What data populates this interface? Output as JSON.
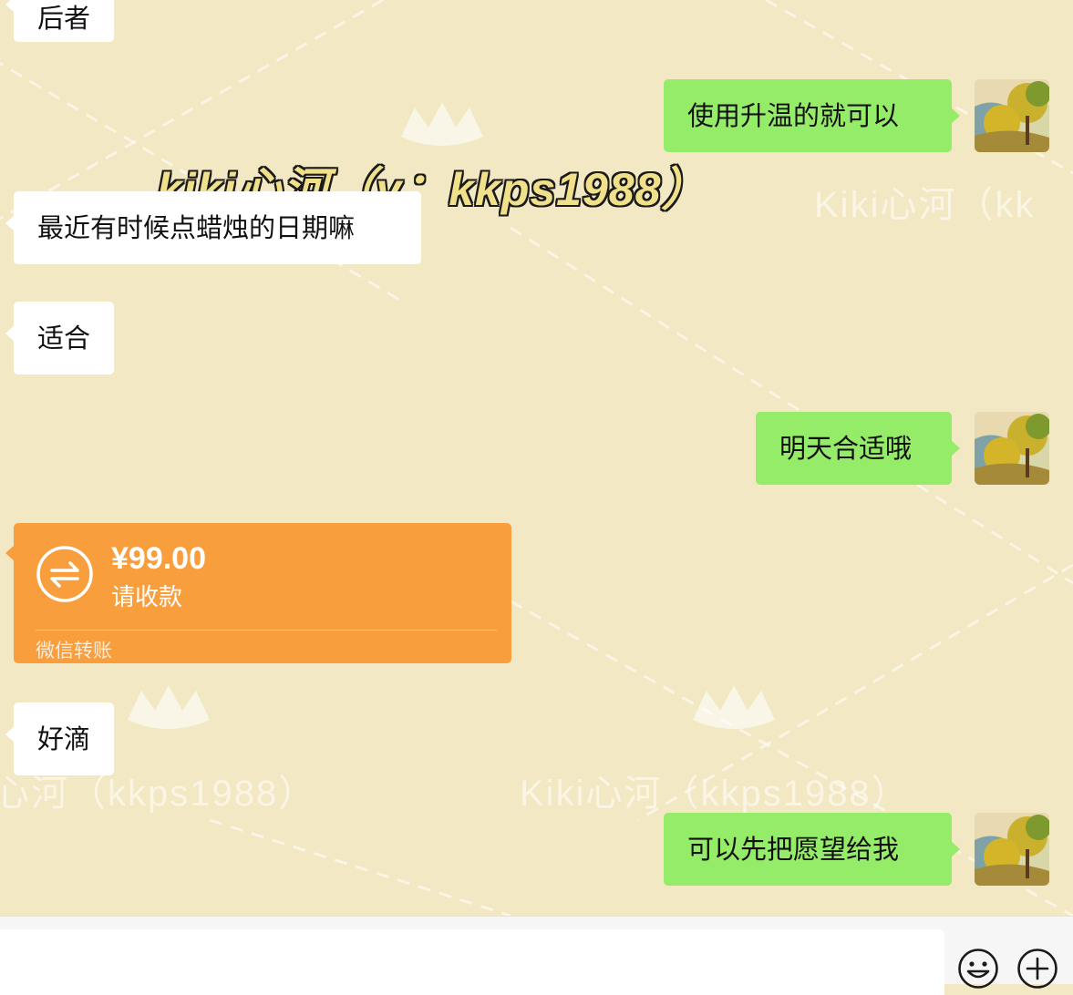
{
  "watermarks": {
    "overlay": "kiki心河（v：kkps1988）",
    "right_top": "Kiki心河（kk",
    "bottom_left": "心河（kkps1988）",
    "bottom_mid": "Kiki心河（kkps1988）"
  },
  "messages": [
    {
      "side": "in",
      "text": "后者"
    },
    {
      "side": "out",
      "text": "使用升温的就可以"
    },
    {
      "side": "in",
      "text": "最近有时候点蜡烛的日期嘛"
    },
    {
      "side": "in",
      "text": "适合"
    },
    {
      "side": "out",
      "text": "明天合适哦"
    },
    {
      "side": "in",
      "type": "transfer",
      "amount": "¥99.00",
      "status": "请收款",
      "brand": "微信转账"
    },
    {
      "side": "in",
      "text": "好滴"
    },
    {
      "side": "out",
      "text": "可以先把愿望给我"
    }
  ],
  "input": {
    "value": ""
  },
  "toolbar": {
    "emoji_icon": "emoji-icon",
    "plus_icon": "plus-circle-icon"
  },
  "colors": {
    "background": "#f3e8c4",
    "incoming": "#ffffff",
    "outgoing": "#95ec69",
    "transfer": "#f99e3d"
  }
}
